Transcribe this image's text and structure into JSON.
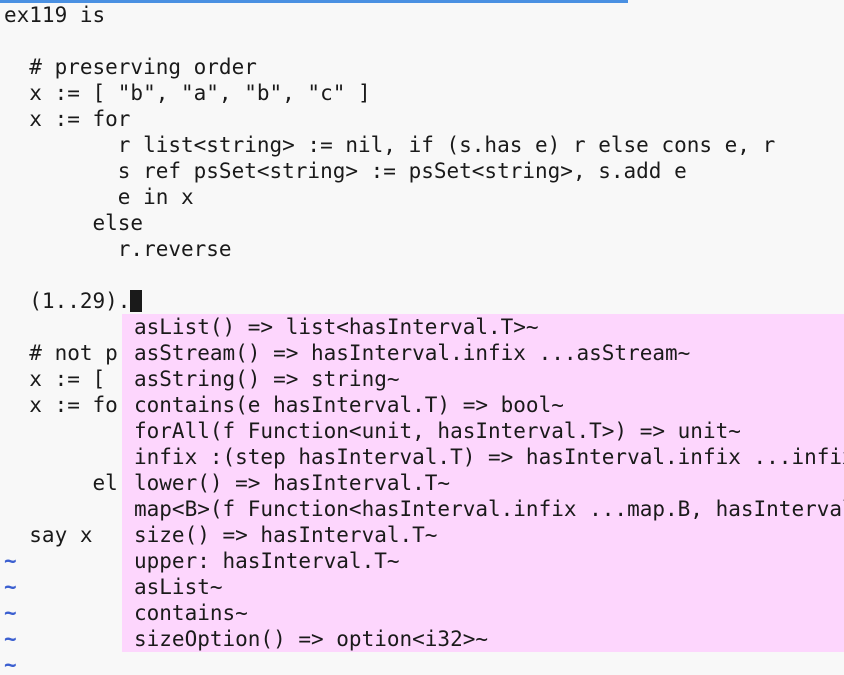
{
  "editor": {
    "lines": [
      "ex119 is",
      "",
      "  # preserving order",
      "  x := [ \"b\", \"a\", \"b\", \"c\" ]",
      "  x := for",
      "         r list<string> := nil, if (s.has e) r else cons e, r",
      "         s ref psSet<string> := psSet<string>, s.add e",
      "         e in x",
      "       else",
      "         r.reverse",
      "",
      "  (1..29).",
      "",
      "  # not p",
      "  x := [",
      "  x := fo",
      "",
      "",
      "       el",
      "",
      "  say x"
    ],
    "tilde": "~"
  },
  "completion": {
    "items": [
      "asList() => list<hasInterval.T>~",
      "asStream() => hasInterval.infix ...asStream~",
      "asString() => string~",
      "contains(e hasInterval.T) => bool~",
      "forAll(f Function<unit, hasInterval.T>) => unit~",
      "infix :(step hasInterval.T) => hasInterval.infix ...infix",
      "lower() => hasInterval.T~",
      "map<B>(f Function<hasInterval.infix ...map.B, hasInterval",
      "size() => hasInterval.T~",
      "upper: hasInterval.T~",
      "asList~",
      "contains~",
      "sizeOption() => option<i32>~"
    ]
  },
  "colors": {
    "popup_bg": "#fdd6fd",
    "tilde": "#3b5fd0",
    "progress": "#4a90e2"
  }
}
